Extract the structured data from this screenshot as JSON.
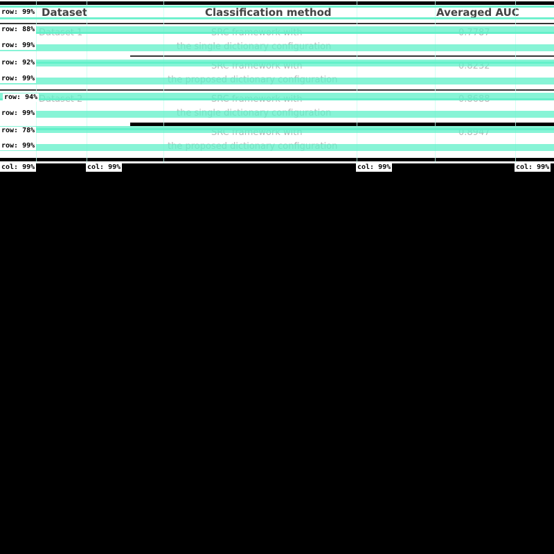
{
  "table": {
    "headers": [
      "Dataset",
      "Classification method",
      "Averaged AUC"
    ],
    "rows": [
      {
        "dataset": "Dataset 1",
        "method_line1": "SRC framework with",
        "method_line2": "the single dictionary configuration",
        "auc": "0.7787"
      },
      {
        "dataset": "",
        "method_line1": "SRC framework with",
        "method_line2": "the proposed dictionary configuration",
        "auc": "0.8232"
      },
      {
        "dataset": "Dataset 2",
        "method_line1": "SRC framework with",
        "method_line2": "the single dictionary configuration",
        "auc": "0.8688"
      },
      {
        "dataset": "",
        "method_line1": "SRC framework with",
        "method_line2": "the proposed dictionary configuration",
        "auc": "0.8947"
      }
    ]
  },
  "overlay": {
    "row_tags": [
      "row: 99%",
      "row: 88%",
      "row: 99%",
      "row: 92%",
      "row: 99%",
      "row: 94%",
      "row: 99%",
      "row: 78%",
      "row: 99%"
    ],
    "col_tags": [
      "col: 99%",
      "col: 99%",
      "col: 99%",
      "col: 99%"
    ],
    "band_color": "#5ff0c8"
  }
}
